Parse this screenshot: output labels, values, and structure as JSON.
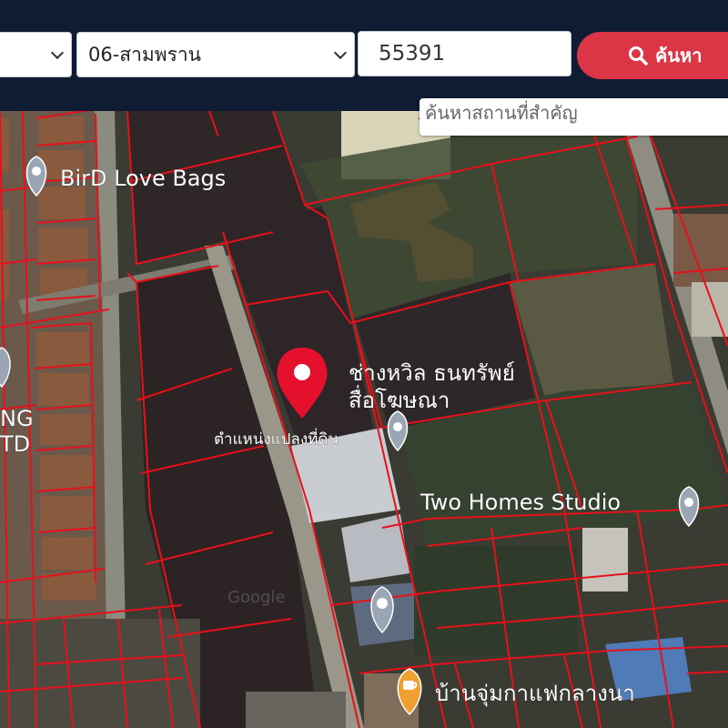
{
  "header": {
    "province_select": {
      "value": ""
    },
    "district_select": {
      "value": "06-สามพราน"
    },
    "parcel_input": {
      "value": "55391"
    },
    "search_button": {
      "label": "ค้นหา",
      "icon": "search-icon"
    }
  },
  "map": {
    "poi_search_placeholder": "ค้นหาสถานที่สำคัญ",
    "marker_label": "ตำแหน่งแปลงที่ดิน",
    "places": {
      "bird_love_bags": "BirD Love Bags",
      "chang_wil": "ช่างหวิล ธนทรัพย์",
      "chang_wil_line2": "สื่อโฆษณา",
      "two_homes": "Two Homes Studio",
      "ban_chum": "บ้านจุ่มกาแฟกลางนา",
      "left_partial_1": "NG",
      "left_partial_2": "TD"
    },
    "watermark": "Google",
    "colors": {
      "parcel_line": "#e8101a",
      "marker": "#e5102b",
      "accent": "#dc3545",
      "header_bg": "#0f1c33"
    }
  }
}
